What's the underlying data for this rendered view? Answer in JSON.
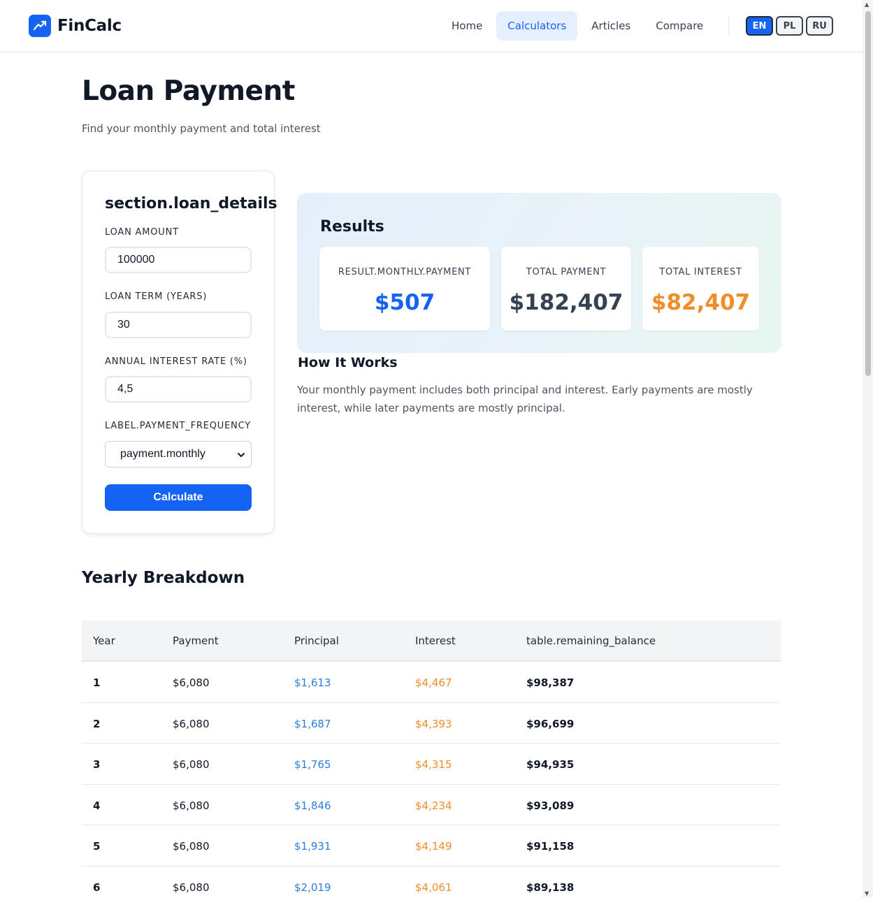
{
  "app": {
    "name": "FinCalc"
  },
  "nav": {
    "items": [
      {
        "label": "Home"
      },
      {
        "label": "Calculators"
      },
      {
        "label": "Articles"
      },
      {
        "label": "Compare"
      }
    ],
    "active": "Calculators"
  },
  "languages": [
    {
      "label": "EN"
    },
    {
      "label": "PL"
    },
    {
      "label": "RU"
    }
  ],
  "active_language": "EN",
  "page": {
    "title": "Loan Payment",
    "subtitle": "Find your monthly payment and total interest"
  },
  "form": {
    "title": "section.loan_details",
    "loan_amount_label": "LOAN AMOUNT",
    "loan_amount_value": "100000",
    "loan_term_label": "LOAN TERM (YEARS)",
    "loan_term_value": "30",
    "interest_rate_label": "ANNUAL INTEREST RATE (%)",
    "interest_rate_value": "4,5",
    "frequency_label": "LABEL.PAYMENT_FREQUENCY",
    "frequency_value": "payment.monthly",
    "calculate_label": "Calculate"
  },
  "results": {
    "title": "Results",
    "monthly_label": "RESULT.MONTHLY.PAYMENT",
    "monthly_value": "$507",
    "total_payment_label": "TOTAL PAYMENT",
    "total_payment_value": "$182,407",
    "total_interest_label": "TOTAL INTEREST",
    "total_interest_value": "$82,407"
  },
  "how_it_works": {
    "title": "How It Works",
    "text": "Your monthly payment includes both principal and interest. Early payments are mostly interest, while later payments are mostly principal."
  },
  "breakdown": {
    "title": "Yearly Breakdown",
    "columns": [
      "Year",
      "Payment",
      "Principal",
      "Interest",
      "table.remaining_balance"
    ],
    "rows": [
      {
        "year": "1",
        "payment": "$6,080",
        "principal": "$1,613",
        "interest": "$4,467",
        "balance": "$98,387"
      },
      {
        "year": "2",
        "payment": "$6,080",
        "principal": "$1,687",
        "interest": "$4,393",
        "balance": "$96,699"
      },
      {
        "year": "3",
        "payment": "$6,080",
        "principal": "$1,765",
        "interest": "$4,315",
        "balance": "$94,935"
      },
      {
        "year": "4",
        "payment": "$6,080",
        "principal": "$1,846",
        "interest": "$4,234",
        "balance": "$93,089"
      },
      {
        "year": "5",
        "payment": "$6,080",
        "principal": "$1,931",
        "interest": "$4,149",
        "balance": "$91,158"
      },
      {
        "year": "6",
        "payment": "$6,080",
        "principal": "$2,019",
        "interest": "$4,061",
        "balance": "$89,138"
      }
    ]
  },
  "colors": {
    "accent": "#1463f3",
    "monthly_value": "#1463f3",
    "total_payment_value": "#374151",
    "total_interest_value": "#f28c28",
    "principal": "#2a7de1",
    "interest": "#f28c28"
  },
  "icons": {
    "logo": "trending-up-icon",
    "select": "chevron-down-icon"
  }
}
